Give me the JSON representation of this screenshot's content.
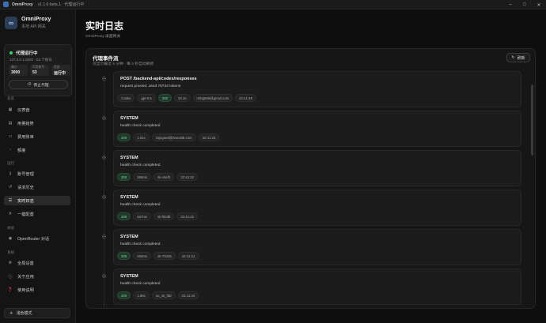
{
  "window": {
    "app_name": "OmniProxy",
    "version_text": "v1.1.6-beta.1 · 代理运行中",
    "controls": [
      "minimize-icon",
      "maximize-icon",
      "close-icon"
    ]
  },
  "sidebar": {
    "brand_name": "OmniProxy",
    "brand_sub": "本地 API 网关",
    "status": {
      "label": "代理运行中",
      "address": "127.0.0.1:3000 · 53 个账号",
      "stats": [
        {
          "label": "端口",
          "value": "3000"
        },
        {
          "label": "可用账号",
          "value": "53"
        },
        {
          "label": "状态",
          "value": "运行中"
        }
      ],
      "stop_label": "停止代理"
    },
    "sections": {
      "overview": "总览",
      "run": "运行",
      "tools": "体验",
      "system": "系统"
    },
    "items": {
      "dashboard": "仪表盘",
      "usage": "用量趋势",
      "billing": "费用账单",
      "quota": "额度",
      "accounts": "账号管理",
      "history": "请求历史",
      "logs": "实时日志",
      "oneclick": "一键配置",
      "openrouter": "OpenRouter 对话",
      "settings": "全局设置",
      "about": "关于应用",
      "guide": "使用说明"
    },
    "theme_label": "浅色模式"
  },
  "main": {
    "title": "实时日志",
    "subtitle": "OmniProxy 桌面网关",
    "panel": {
      "title": "代理事件流",
      "subtitle": "仅显示最近 5 分钟 · 每 5 秒自动刷新",
      "refresh_label": "刷新"
    },
    "events": [
      {
        "title": "POST /backend-api/codex/responses",
        "message": "request proxied, used 78743 tokens",
        "chips": [
          {
            "text": "Codex",
            "ok": false
          },
          {
            "text": "gpt-5.5",
            "ok": false
          },
          {
            "text": "200",
            "ok": true
          },
          {
            "text": "34.2s",
            "ok": false
          },
          {
            "text": "mtbg665@gmail.com",
            "ok": false
          },
          {
            "text": "22:41:49",
            "ok": false
          }
        ]
      },
      {
        "title": "SYSTEM",
        "message": "health check completed",
        "chips": [
          {
            "text": "200",
            "ok": true
          },
          {
            "text": "1.01s",
            "ok": false
          },
          {
            "text": "zujayaed@zanolab.com",
            "ok": false
          },
          {
            "text": "22:41:23",
            "ok": false
          }
        ]
      },
      {
        "title": "SYSTEM",
        "message": "health check completed",
        "chips": [
          {
            "text": "200",
            "ok": true
          },
          {
            "text": "269ms",
            "ok": false
          },
          {
            "text": "sk-c6ef3",
            "ok": false
          },
          {
            "text": "22:41:22",
            "ok": false
          }
        ]
      },
      {
        "title": "SYSTEM",
        "message": "health check completed",
        "chips": [
          {
            "text": "200",
            "ok": true
          },
          {
            "text": "487ms",
            "ok": false
          },
          {
            "text": "sk-fdcd8",
            "ok": false
          },
          {
            "text": "22:41:22",
            "ok": false
          }
        ]
      },
      {
        "title": "SYSTEM",
        "message": "health check completed",
        "chips": [
          {
            "text": "200",
            "ok": true
          },
          {
            "text": "260ms",
            "ok": false
          },
          {
            "text": "sk-75336",
            "ok": false
          },
          {
            "text": "22:41:21",
            "ok": false
          }
        ]
      },
      {
        "title": "SYSTEM",
        "message": "health check completed",
        "chips": [
          {
            "text": "200",
            "ok": true
          },
          {
            "text": "1.80s",
            "ok": false
          },
          {
            "text": "oo_sk_fdd",
            "ok": false
          },
          {
            "text": "22:41:20",
            "ok": false
          }
        ]
      }
    ]
  },
  "colors": {
    "accent_ok": "#3ecf6a",
    "background": "#0f0f0f",
    "panel": "#161616"
  }
}
